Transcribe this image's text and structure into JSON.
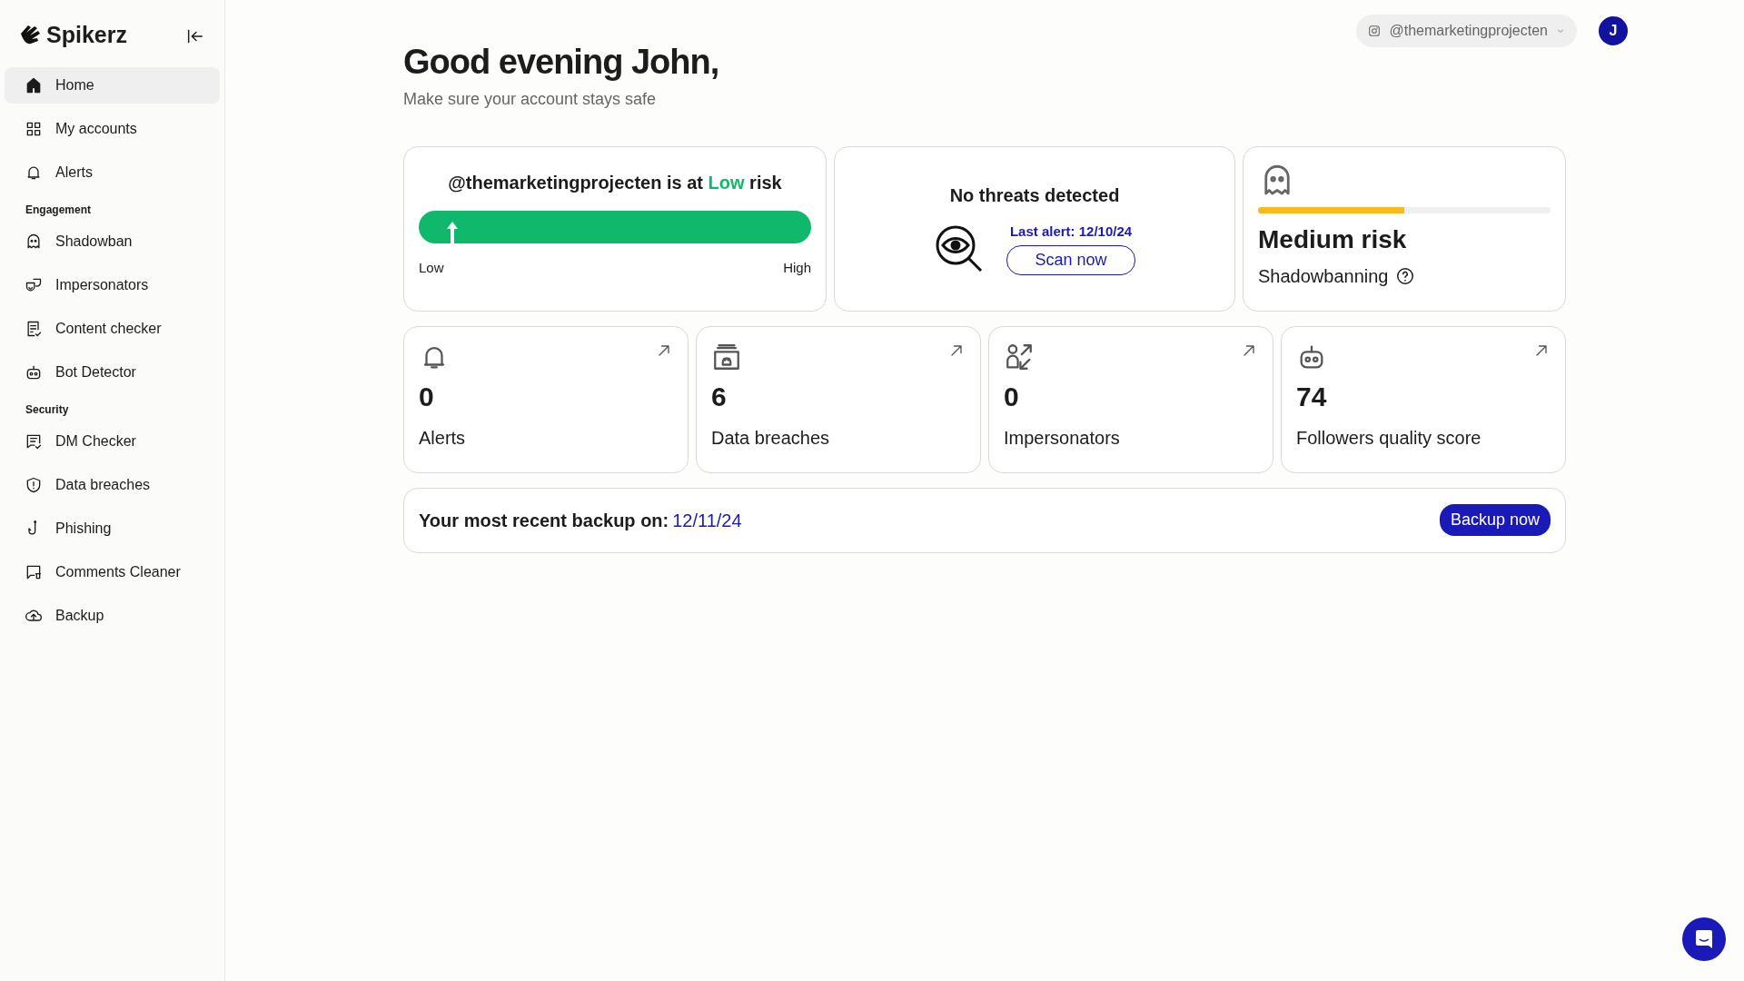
{
  "brand": {
    "name": "Spikerz"
  },
  "sidebar": {
    "sections": [
      {
        "items": [
          {
            "label": "Home",
            "selected": true
          },
          {
            "label": "My accounts",
            "selected": false
          },
          {
            "label": "Alerts",
            "selected": false
          }
        ]
      },
      {
        "heading": "Engagement",
        "items": [
          {
            "label": "Shadowban",
            "selected": false
          },
          {
            "label": "Impersonators",
            "selected": false
          },
          {
            "label": "Content checker",
            "selected": false
          },
          {
            "label": "Bot Detector",
            "selected": false
          }
        ]
      },
      {
        "heading": "Security",
        "items": [
          {
            "label": "DM Checker",
            "selected": false
          },
          {
            "label": "Data breaches",
            "selected": false
          },
          {
            "label": "Phishing",
            "selected": false
          },
          {
            "label": "Comments Cleaner",
            "selected": false
          },
          {
            "label": "Backup",
            "selected": false
          }
        ]
      }
    ]
  },
  "header": {
    "account": "@themarketingprojecten",
    "avatar": "J"
  },
  "greeting": {
    "title": "Good evening John,",
    "subtitle": "Make sure your account stays safe"
  },
  "risk_card": {
    "title": "@themarketingprojecten is at **Low** risk",
    "level": 0.07,
    "low_label": "Low",
    "high_label": "High"
  },
  "threats_card": {
    "title": "No threats detected",
    "last_alert": "Last alert: 12/10/24",
    "button": "Scan now"
  },
  "shadowban_card": {
    "level": 0.5,
    "risk": "Medium risk",
    "label": "Shadowbanning"
  },
  "stats": [
    {
      "value": "0",
      "label": "Alerts"
    },
    {
      "value": "6",
      "label": "Data breaches"
    },
    {
      "value": "0",
      "label": "Impersonators"
    },
    {
      "value": "74",
      "label": "Followers quality score"
    }
  ],
  "backup": {
    "label": "Your most recent backup on:",
    "date": "12/11/24",
    "button": "Backup now"
  }
}
